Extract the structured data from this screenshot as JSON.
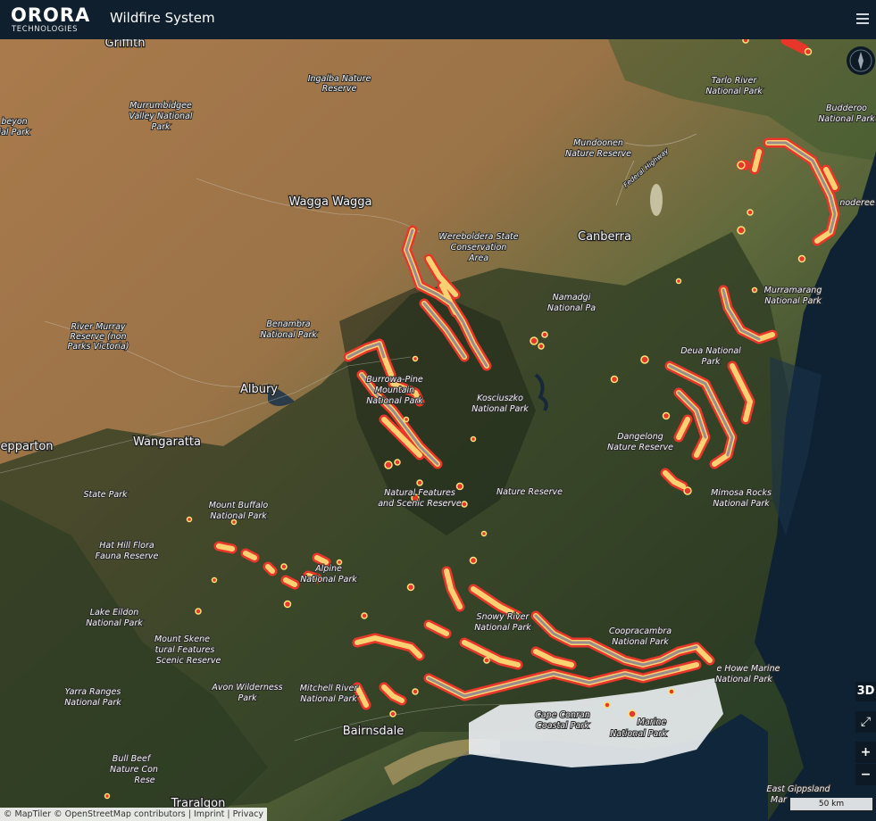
{
  "header": {
    "logo_main": "ORORA",
    "logo_sub": "TECHNOLOGIES",
    "title": "Wildfire System",
    "menu_icon": "hamburger-menu-icon"
  },
  "controls": {
    "view_3d": "3D",
    "fullscreen_glyph": "⤢",
    "zoom_in": "+",
    "zoom_out": "−",
    "compass_icon": "compass-icon"
  },
  "attribution": "© MapTiler © OpenStreetMap contributors | Imprint | Privacy",
  "scale_label": "50 km",
  "colors": {
    "fire_outer": "#e8372a",
    "fire_glow": "#ffe27a",
    "fire_fill": "#9a8d8b",
    "header_bg": "#0f1f2e"
  },
  "labels": {
    "griffith": "Griffith",
    "ingalba": [
      "Ingalba Nature",
      "Reserve"
    ],
    "murrumbidgee": [
      "Murrumbidgee",
      "Valley National",
      "Park"
    ],
    "beyon": [
      "beyon",
      "ial Park"
    ],
    "wagga": "Wagga Wagga",
    "wereboldera": [
      "Wereboldera State",
      "Conservation",
      "Area"
    ],
    "mundoonen": [
      "Mundoonen",
      "Nature Reserve"
    ],
    "federal_hwy": "Federal Highway",
    "canberra": "Canberra",
    "tarlo": [
      "Tarlo River",
      "National Park"
    ],
    "budderoo": [
      "Budderoo",
      "National Park"
    ],
    "moderee": "noderee",
    "murramarang": [
      "Murramarang",
      "National Park"
    ],
    "namadgi": [
      "Namadgi",
      "National Pa"
    ],
    "benambra": [
      "Benambra",
      "National Park"
    ],
    "river_murray": [
      "River Murray",
      "Reserve (non",
      "Parks Victoria)"
    ],
    "albury": "Albury",
    "burrowa": [
      "Burrowa-Pine",
      "Mountain",
      "National Park"
    ],
    "kosciuszko": [
      "Kosciuszko",
      "National Park"
    ],
    "deua": [
      "Deua National",
      "Park"
    ],
    "dangelong": [
      "Dangelong",
      "Nature Reserve"
    ],
    "wangaratta": "Wangaratta",
    "shepparton": "epparton",
    "state_park": "State Park",
    "natural_features": [
      "Natural Features",
      "and Scenic Reserve"
    ],
    "nature_reserve": "Nature Reserve",
    "mimosa": [
      "Mimosa Rocks",
      "National Park"
    ],
    "mount_buffalo": [
      "Mount Buffalo",
      "National Park"
    ],
    "hat_hill": [
      "Hat Hill Flora",
      "Fauna Reserve"
    ],
    "alpine": [
      "Alpine",
      "National Park"
    ],
    "lake_eildon": [
      "Lake Eildon",
      "National Park"
    ],
    "snowy_river": [
      "Snowy River",
      "National Park"
    ],
    "coopracambra": [
      "Coopracambra",
      "National Park"
    ],
    "mount_skene": [
      "Mount Skene",
      "tural Features",
      "Scenic Reserve"
    ],
    "croajingolong": [
      "e Howe Marine",
      "National Park"
    ],
    "yarra_ranges": [
      "Yarra Ranges",
      "National Park"
    ],
    "avon": [
      "Avon Wilderness",
      "Park"
    ],
    "mitchell_river": [
      "Mitchell River",
      "National Park"
    ],
    "cape_conran": [
      "Cape Conran",
      "Coastal Park"
    ],
    "marine_park": [
      "Marine",
      "National Park"
    ],
    "bairnsdale": "Bairnsdale",
    "bull_beef": [
      "Bull Beef",
      "Nature Con",
      "Rese"
    ],
    "traralgon": "Traralgon",
    "east_gippsland": [
      "East Gippsland",
      "Mar"
    ]
  }
}
